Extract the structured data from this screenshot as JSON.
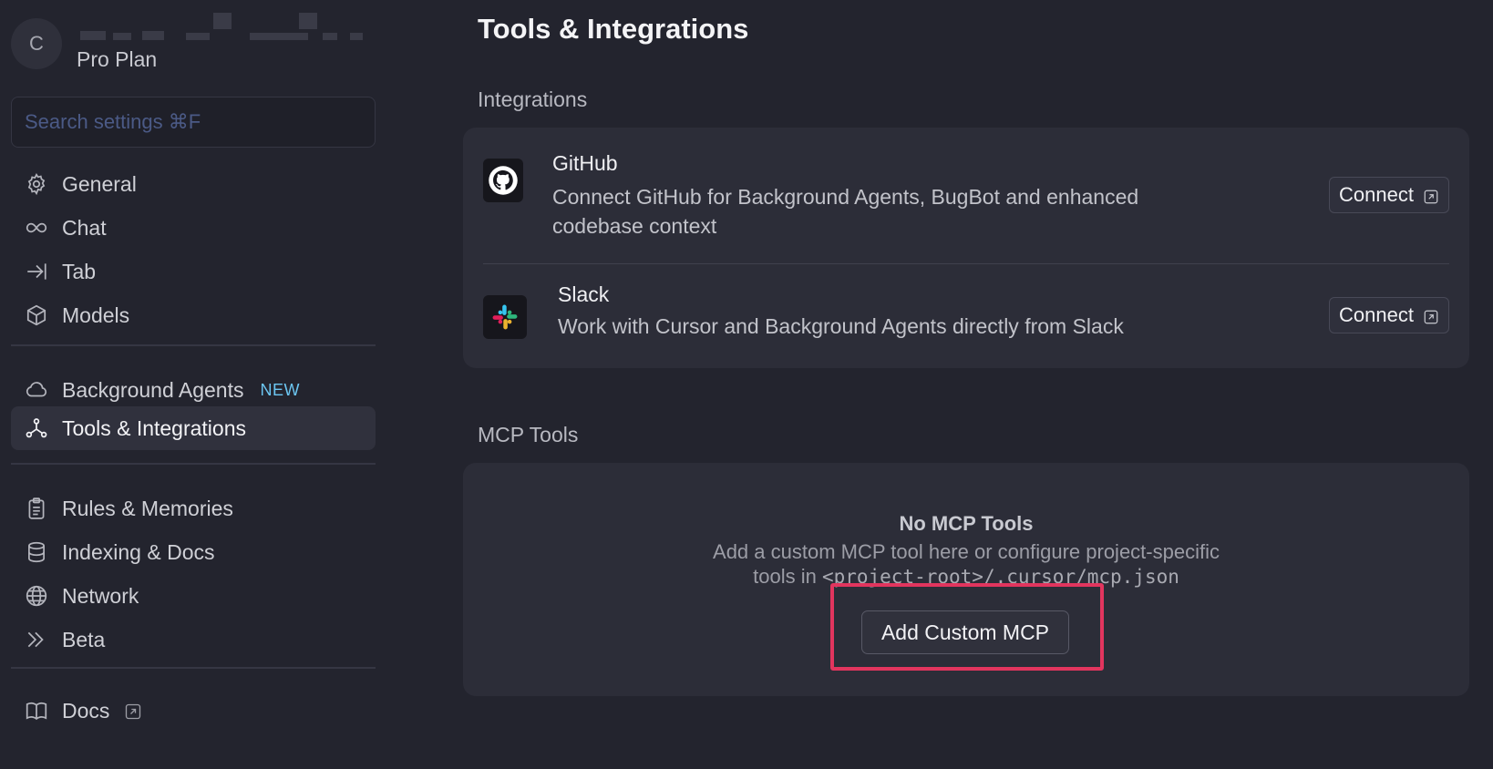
{
  "account": {
    "avatar_letter": "C",
    "plan": "Pro Plan"
  },
  "search": {
    "placeholder": "Search settings ⌘F"
  },
  "sidebar": {
    "items": [
      {
        "label": "General",
        "icon": "gear-icon"
      },
      {
        "label": "Chat",
        "icon": "infinity-icon"
      },
      {
        "label": "Tab",
        "icon": "arrow-to-bar-icon"
      },
      {
        "label": "Models",
        "icon": "cube-icon"
      },
      {
        "label": "Background Agents",
        "icon": "cloud-icon",
        "badge": "NEW"
      },
      {
        "label": "Tools & Integrations",
        "icon": "network-nodes-icon",
        "active": true
      },
      {
        "label": "Rules & Memories",
        "icon": "clipboard-icon"
      },
      {
        "label": "Indexing & Docs",
        "icon": "database-icon"
      },
      {
        "label": "Network",
        "icon": "globe-icon"
      },
      {
        "label": "Beta",
        "icon": "double-chevron-icon"
      },
      {
        "label": "Docs",
        "icon": "book-icon"
      }
    ]
  },
  "main": {
    "title": "Tools & Integrations",
    "integrations_label": "Integrations",
    "integrations": [
      {
        "name": "GitHub",
        "description": "Connect GitHub for Background Agents, BugBot and enhanced codebase context",
        "button": "Connect",
        "icon": "github-icon"
      },
      {
        "name": "Slack",
        "description": "Work with Cursor and Background Agents directly from Slack",
        "button": "Connect",
        "icon": "slack-icon"
      }
    ],
    "mcp_label": "MCP Tools",
    "mcp_empty": {
      "title": "No MCP Tools",
      "desc_line1": "Add a custom MCP tool here or configure project-specific",
      "desc_line2_prefix": "tools in ",
      "desc_path": "<project-root>/.cursor/mcp.json",
      "button": "Add Custom MCP"
    }
  },
  "colors": {
    "background": "#23242e",
    "card": "#2c2d38",
    "active_item": "#30313d",
    "badge": "#6cc6f2",
    "highlight": "#e2355e"
  }
}
